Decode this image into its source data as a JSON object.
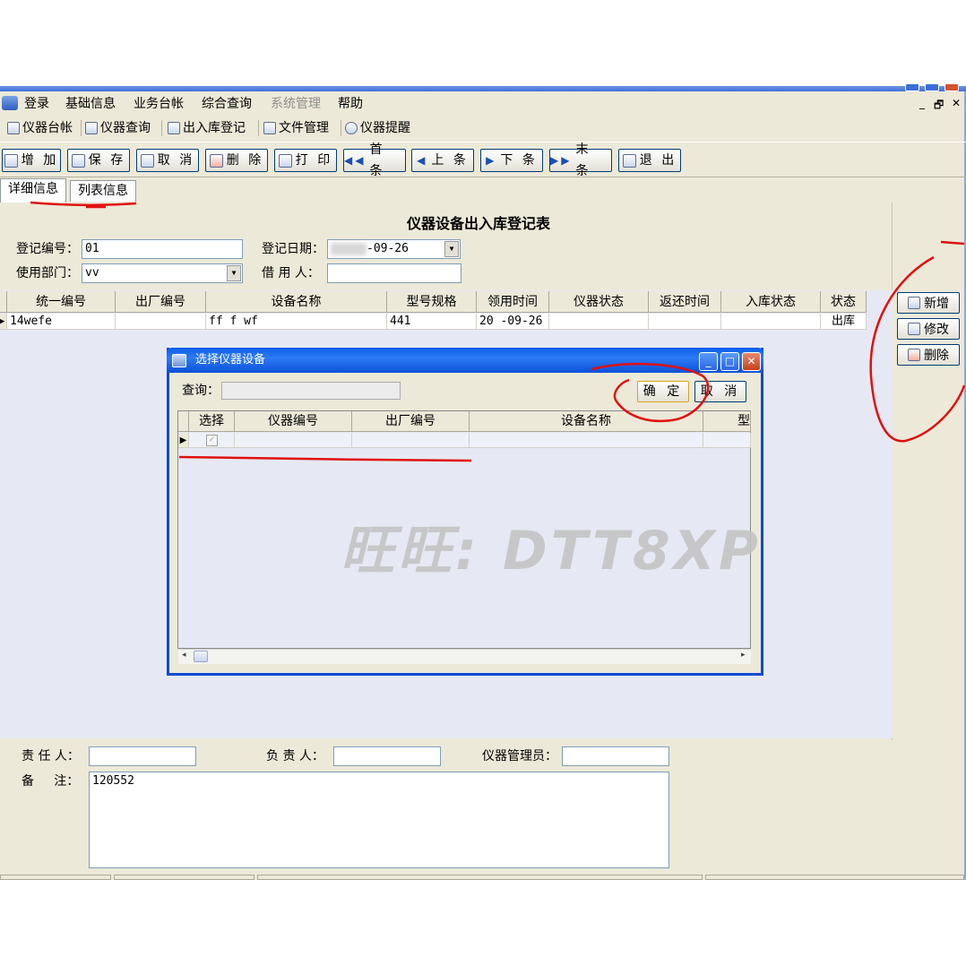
{
  "menu": {
    "items": [
      {
        "label": "登录",
        "disabled": false
      },
      {
        "label": "基础信息",
        "disabled": false
      },
      {
        "label": "业务台帐",
        "disabled": false
      },
      {
        "label": "综合查询",
        "disabled": false
      },
      {
        "label": "系统管理",
        "disabled": true
      },
      {
        "label": "帮助",
        "disabled": false
      }
    ],
    "mdi_controls": [
      "_",
      "🗗",
      "✕"
    ]
  },
  "quick_toolbar": [
    "仪器台帐",
    "仪器查询",
    "出入库登记",
    "文件管理",
    "仪器提醒"
  ],
  "actions": [
    "增 加",
    "保 存",
    "取 消",
    "删 除",
    "打 印",
    "首 条",
    "上 条",
    "下 条",
    "末 条",
    "退 出"
  ],
  "tabs": [
    "详细信息",
    "列表信息"
  ],
  "form": {
    "title": "仪器设备出入库登记表",
    "reg_no_label": "登记编号：",
    "reg_no_value": "01",
    "reg_date_label": "登记日期：",
    "reg_date_value": "-09-26",
    "dept_label": "使用部门：",
    "dept_value": "vv",
    "borrower_label": "借 用 人：",
    "borrower_value": ""
  },
  "grid": {
    "columns": [
      "统一编号",
      "出厂编号",
      "设备名称",
      "型号规格",
      "领用时间",
      "仪器状态",
      "返还时间",
      "入库状态",
      "状态"
    ],
    "rows": [
      [
        "14wefe",
        "",
        "ff f wf",
        "441",
        "20 -09-26",
        "",
        "",
        "",
        "出库"
      ]
    ]
  },
  "side_buttons": [
    "新增",
    "修改",
    "删除"
  ],
  "dialog": {
    "title": "选择仪器设备",
    "query_label": "查询：",
    "query_value": "",
    "ok_label": "确 定",
    "cancel_label": "取 消",
    "columns": [
      "选择",
      "仪器编号",
      "出厂编号",
      "设备名称",
      "型"
    ],
    "watermark": "旺旺: DTT8XP"
  },
  "bottom": {
    "responsible_label": "责 任 人：",
    "responsible_value": "",
    "principal_label": "负 责 人：",
    "principal_value": "",
    "admin_label": "仪器管理员：",
    "admin_value": "",
    "remark_label": "备     注：",
    "remark_value": "120552"
  },
  "colors": {
    "annotation_red": "#e01010",
    "xp_blue": "#0a4bd1"
  }
}
